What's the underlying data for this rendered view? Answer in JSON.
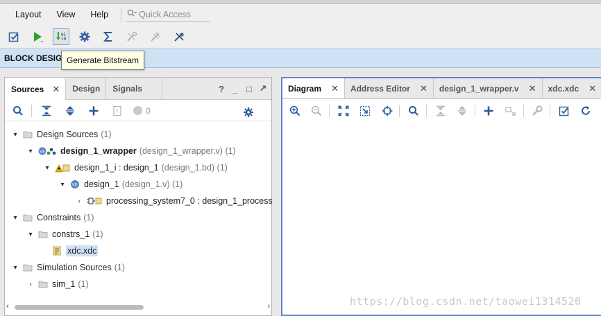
{
  "menu": {
    "items": [
      {
        "label": "Layout"
      },
      {
        "label": "View"
      },
      {
        "label": "Help"
      }
    ],
    "quick_access_placeholder": "Quick Access"
  },
  "tooltip": {
    "text": "Generate Bitstream"
  },
  "block_design": {
    "title": "BLOCK DESIGN"
  },
  "left_panel": {
    "tabs": [
      {
        "label": "Sources",
        "active": true
      },
      {
        "label": "Design",
        "active": false
      },
      {
        "label": "Signals",
        "active": false
      }
    ],
    "controls": {
      "help": "?",
      "minimize": "_",
      "restore": "□",
      "detach": "↗"
    },
    "toolbar": {
      "count": "0"
    },
    "tree": {
      "design_sources": {
        "label": "Design Sources",
        "count": "(1)"
      },
      "wrapper": {
        "label": "design_1_wrapper",
        "detail": "(design_1_wrapper.v) (1)"
      },
      "design_1_i": {
        "label": "design_1_i : design_1",
        "detail": "(design_1.bd) (1)"
      },
      "design_1": {
        "label": "design_1",
        "detail": "(design_1.v) (1)"
      },
      "ps7": {
        "label": "processing_system7_0 : design_1_process"
      },
      "constraints": {
        "label": "Constraints",
        "count": "(1)"
      },
      "constrs_1": {
        "label": "constrs_1",
        "count": "(1)"
      },
      "xdc": {
        "label": "xdc.xdc"
      },
      "sim_sources": {
        "label": "Simulation Sources",
        "count": "(1)"
      },
      "sim_1": {
        "label": "sim_1",
        "count": "(1)"
      }
    }
  },
  "right_panel": {
    "tabs": [
      {
        "label": "Diagram",
        "active": true
      },
      {
        "label": "Address Editor",
        "active": false
      },
      {
        "label": "design_1_wrapper.v",
        "active": false
      },
      {
        "label": "xdc.xdc",
        "active": false
      }
    ]
  },
  "watermark": {
    "text": "https://blog.csdn.net/taowei1314520"
  },
  "colors": {
    "accent_blue": "#5b86c5",
    "header_blue": "#cfe1f5",
    "run_green": "#2aa52a"
  }
}
